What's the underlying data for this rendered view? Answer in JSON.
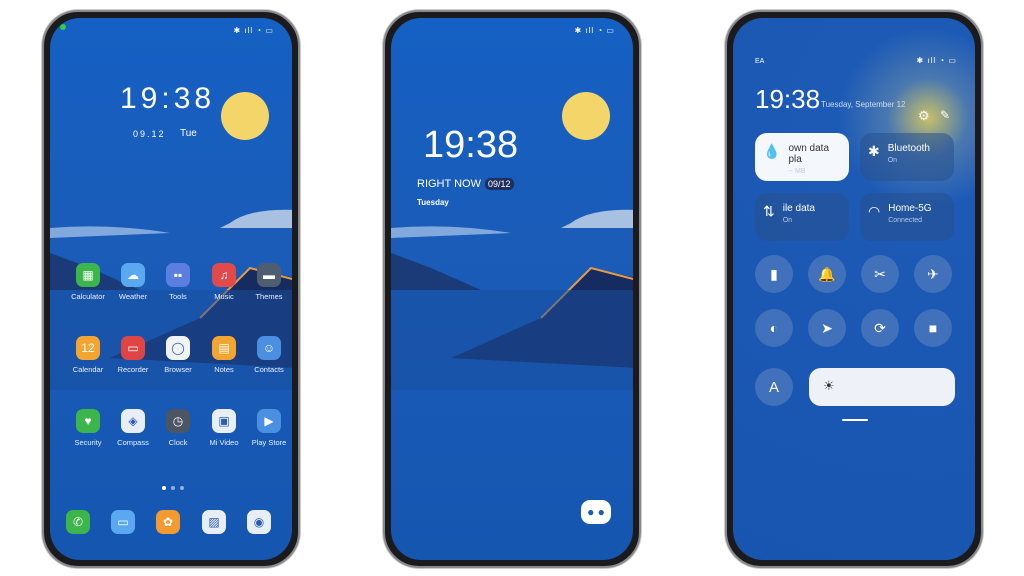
{
  "status_icons": "✱ ıll ◔ ▭",
  "home": {
    "time": "19:38",
    "date": "09.12",
    "day": "Tue",
    "apps": [
      {
        "label": "Calculator",
        "icon": "calculator-icon",
        "color": "#3cb54a",
        "glyph": "▦"
      },
      {
        "label": "Weather",
        "icon": "weather-icon",
        "color": "#5aa8f0",
        "glyph": "☁"
      },
      {
        "label": "Tools",
        "icon": "tools-folder-icon",
        "color": "#5b7fe0",
        "glyph": "▪▪"
      },
      {
        "label": "Music",
        "icon": "music-icon",
        "color": "#e24a4a",
        "glyph": "♫"
      },
      {
        "label": "Themes",
        "icon": "themes-icon",
        "color": "#4e5d70",
        "glyph": "▬"
      },
      {
        "label": "Calendar",
        "icon": "calendar-icon",
        "color": "#f2a531",
        "glyph": "12"
      },
      {
        "label": "Recorder",
        "icon": "recorder-icon",
        "color": "#e04545",
        "glyph": "▭"
      },
      {
        "label": "Browser",
        "icon": "browser-icon",
        "color": "#f0f2f6",
        "glyph": "◯"
      },
      {
        "label": "Notes",
        "icon": "notes-icon",
        "color": "#f2a531",
        "glyph": "▤"
      },
      {
        "label": "Contacts",
        "icon": "contacts-icon",
        "color": "#4a8fe0",
        "glyph": "☺"
      },
      {
        "label": "Security",
        "icon": "security-icon",
        "color": "#3cb54a",
        "glyph": "♥"
      },
      {
        "label": "Compass",
        "icon": "compass-icon",
        "color": "#e8eef6",
        "glyph": "◈"
      },
      {
        "label": "Clock",
        "icon": "clock-icon",
        "color": "#4b5563",
        "glyph": "◷"
      },
      {
        "label": "Mi Video",
        "icon": "mi-video-icon",
        "color": "#e8eef6",
        "glyph": "▣"
      },
      {
        "label": "Play Store",
        "icon": "play-store-icon",
        "color": "#4a8fe0",
        "glyph": "▶"
      }
    ],
    "dock": [
      {
        "icon": "phone-icon",
        "color": "#3cb54a",
        "glyph": "✆"
      },
      {
        "icon": "messages-icon",
        "color": "#5aa8f0",
        "glyph": "▭"
      },
      {
        "icon": "gallery-icon",
        "color": "#f29a31",
        "glyph": "✿"
      },
      {
        "icon": "photos-icon",
        "color": "#e8eef6",
        "glyph": "▨"
      },
      {
        "icon": "camera-icon",
        "color": "#e8eef6",
        "glyph": "◉"
      }
    ]
  },
  "lock": {
    "time": "19:38",
    "right_now": "RIGHT NOW",
    "date": "09/12",
    "day": "Tuesday"
  },
  "control": {
    "carrier": "EA",
    "time": "19:38",
    "date": "Tuesday, September 12",
    "tiles": [
      {
        "title": "own data pla",
        "sub": "-- MB",
        "icon": "water-drop-icon",
        "glyph": "💧",
        "active": true
      },
      {
        "title": "Bluetooth",
        "sub": "On",
        "icon": "bluetooth-icon",
        "glyph": "✱"
      },
      {
        "title": "ile data",
        "sub": "On",
        "icon": "mobile-data-icon",
        "glyph": "⇅"
      },
      {
        "title": "Home-5G",
        "sub": "Connected",
        "icon": "wifi-icon",
        "glyph": "◠"
      }
    ],
    "toggles": [
      {
        "icon": "flashlight-icon",
        "glyph": "▮"
      },
      {
        "icon": "bell-icon",
        "glyph": "🔔"
      },
      {
        "icon": "screenshot-icon",
        "glyph": "✂"
      },
      {
        "icon": "airplane-icon",
        "glyph": "✈"
      },
      {
        "icon": "dark-mode-icon",
        "glyph": "◐"
      },
      {
        "icon": "location-icon",
        "glyph": "➤"
      },
      {
        "icon": "rotation-lock-icon",
        "glyph": "⟳"
      },
      {
        "icon": "video-icon",
        "glyph": "■"
      }
    ],
    "font_label": "A"
  }
}
